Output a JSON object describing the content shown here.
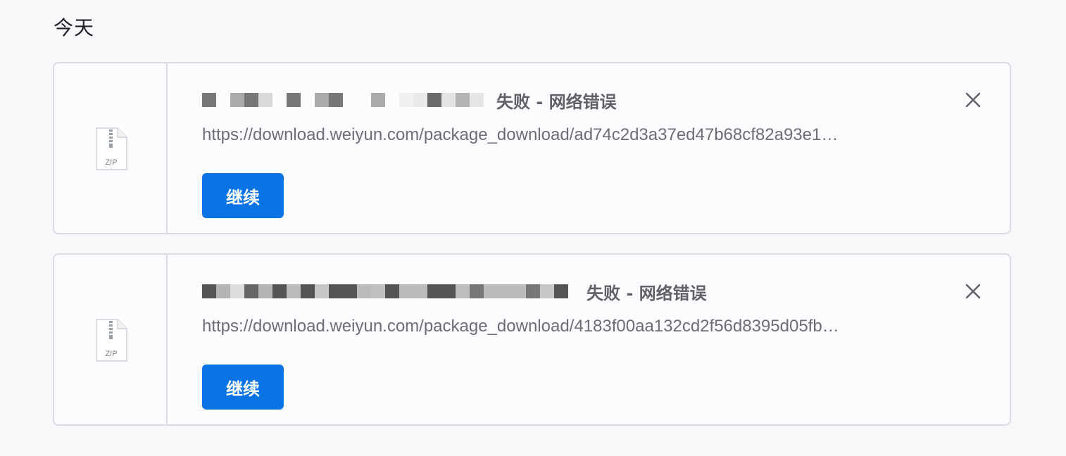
{
  "section": {
    "title": "今天"
  },
  "downloads": [
    {
      "file_type_label": "ZIP",
      "status": "失败 - 网络错误",
      "url": "https://download.weiyun.com/package_download/ad74c2d3a37ed47b68cf82a93e1…",
      "resume_label": "继续",
      "redacted_pattern": [
        "#777777",
        "#fbfcfd",
        "#aaaaaa",
        "#777777",
        "#d9d9d9",
        "#fbfcfd",
        "#777777",
        "#fbfcfd",
        "#aaaaaa",
        "#777777",
        "#fbfcfd",
        "#fbfcfd",
        "#aaaaaa",
        "#fbfcfd",
        "#f0f0f0",
        "#e9e9e9",
        "#6a6a6a",
        "#e3e3e3",
        "#b5b5b5",
        "#e6e6e6"
      ]
    },
    {
      "file_type_label": "ZIP",
      "status": "失败 - 网络错误",
      "url": "https://download.weiyun.com/package_download/4183f00aa132cd2f56d8395d05fb…",
      "resume_label": "继续",
      "redacted_pattern": [
        "#555555",
        "#b5b5b5",
        "#dddddd",
        "#666666",
        "#b5b5b5",
        "#555555",
        "#bbbbbb",
        "#555555",
        "#c8c8c8",
        "#555555",
        "#555555",
        "#bbbbbb",
        "#c0c0c0",
        "#555555",
        "#bbbbbb",
        "#bbbbbb",
        "#555555",
        "#555555",
        "#bdbdbd",
        "#777777",
        "#bbbbbb",
        "#bbbbbb",
        "#bbbbbb",
        "#777777",
        "#c8c8c8",
        "#555555"
      ]
    }
  ]
}
